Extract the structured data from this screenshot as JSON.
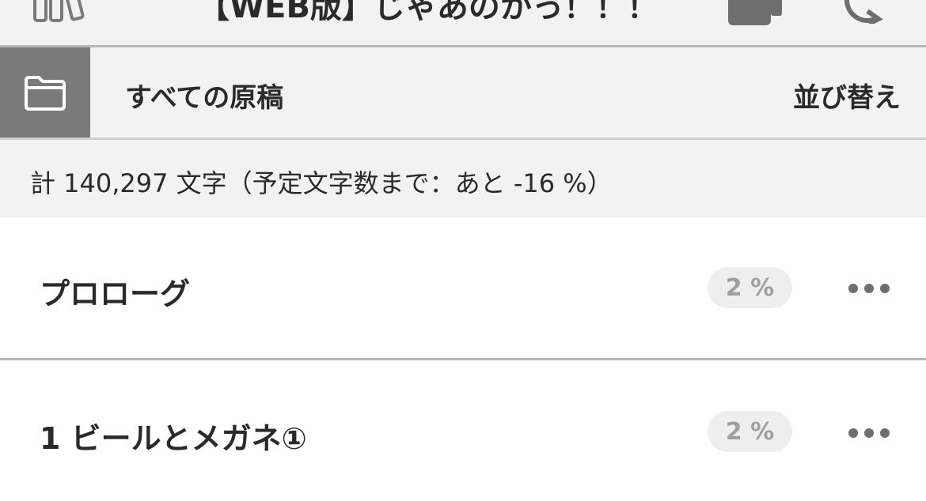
{
  "header": {
    "title": "【WEB版】じゃあのかっ！！！"
  },
  "folder": {
    "label": "すべての原稿",
    "sort_label": "並び替え"
  },
  "summary": {
    "text": "計 140,297 文字（予定文字数まで：あと -16 %）"
  },
  "items": [
    {
      "title": "プロローグ",
      "percent": "2 %"
    },
    {
      "title": "1 ビールとメガネ①",
      "percent": "2 %"
    }
  ],
  "colors": {
    "background": "#f2f2f2",
    "folder_tile": "#7a7a7a",
    "badge_bg": "#eeeeee",
    "badge_text": "#9f9f9f",
    "text": "#2a2a2a"
  },
  "icons": [
    "books-icon",
    "document-icon",
    "sync-icon",
    "folder-icon",
    "more-icon"
  ]
}
